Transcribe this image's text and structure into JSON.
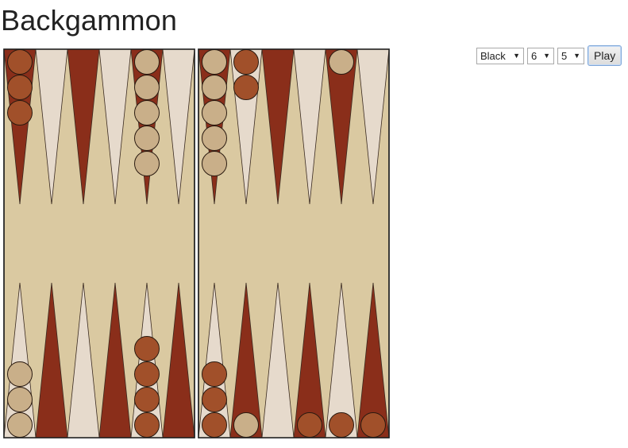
{
  "page": {
    "title": "Backgammon"
  },
  "controls": {
    "player_selected": "Black",
    "die1_selected": "6",
    "die2_selected": "5",
    "play_label": "Play"
  },
  "colors": {
    "board_bg": "#dac9a1",
    "point_dark": "#8a2e1a",
    "point_light": "#e6dacc",
    "checker_dark": "#a1502a",
    "checker_light": "#c9af89",
    "frame": "#222222"
  },
  "board": {
    "top_points": [
      {
        "color": "dark",
        "checkers": {
          "color": "dark",
          "count": 3
        }
      },
      {
        "color": "light",
        "checkers": null
      },
      {
        "color": "dark",
        "checkers": null
      },
      {
        "color": "light",
        "checkers": null
      },
      {
        "color": "dark",
        "checkers": {
          "color": "light",
          "count": 5
        }
      },
      {
        "color": "light",
        "checkers": null
      },
      {
        "color": "dark",
        "checkers": {
          "color": "light",
          "count": 5
        }
      },
      {
        "color": "light",
        "checkers": {
          "color": "dark",
          "count": 2
        }
      },
      {
        "color": "dark",
        "checkers": null
      },
      {
        "color": "light",
        "checkers": null
      },
      {
        "color": "dark",
        "checkers": {
          "color": "light",
          "count": 1
        }
      },
      {
        "color": "light",
        "checkers": null
      }
    ],
    "bottom_points": [
      {
        "color": "light",
        "checkers": {
          "color": "light",
          "count": 3
        }
      },
      {
        "color": "dark",
        "checkers": null
      },
      {
        "color": "light",
        "checkers": null
      },
      {
        "color": "dark",
        "checkers": null
      },
      {
        "color": "light",
        "checkers": {
          "color": "dark",
          "count": 4
        }
      },
      {
        "color": "dark",
        "checkers": null
      },
      {
        "color": "light",
        "checkers": {
          "color": "dark",
          "count": 3
        }
      },
      {
        "color": "dark",
        "checkers": {
          "color": "light",
          "count": 1
        }
      },
      {
        "color": "light",
        "checkers": null
      },
      {
        "color": "dark",
        "checkers": {
          "color": "dark",
          "count": 1
        }
      },
      {
        "color": "light",
        "checkers": {
          "color": "dark",
          "count": 1
        }
      },
      {
        "color": "dark",
        "checkers": {
          "color": "dark",
          "count": 1
        }
      }
    ]
  }
}
